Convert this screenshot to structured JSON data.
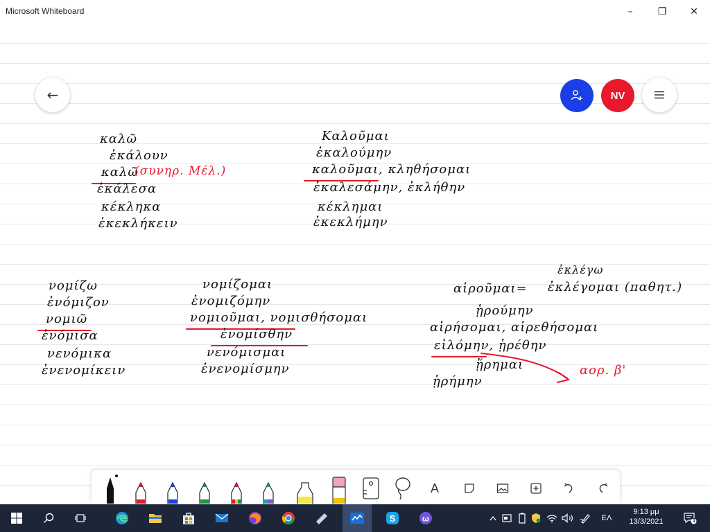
{
  "window": {
    "title": "Microsoft Whiteboard",
    "minimize": "–",
    "maximize": "❐",
    "close": "✕"
  },
  "header": {
    "back_symbol": "←",
    "avatar_initials": "NV"
  },
  "colors": {
    "ink": "#111111",
    "accent_red": "#e8192c",
    "share_blue": "#1b3fe6",
    "taskbar": "#1c2638"
  },
  "board": {
    "block1": {
      "lines": [
        "καλῶ",
        "ἐκάλουν",
        "καλῶ",
        "ἐκάλεσα",
        "κέκληκα",
        "ἐκεκλήκειν"
      ],
      "note": "(συνηρ. Μέλ.)"
    },
    "block2": {
      "lines": [
        "Καλοῦμαι",
        "ἐκαλούμην",
        "καλοῦμαι, κληθήσομαι",
        "ἐκαλεσάμην, ἐκλήθην",
        "κέκλημαι",
        "ἐκεκλήμην"
      ]
    },
    "block3": {
      "lines": [
        "νομίζω",
        "ἐνόμιζον",
        "νομιῶ",
        "ἐνόμισα",
        "νενόμικα",
        "ἐνενομίκειν"
      ]
    },
    "block4": {
      "lines": [
        "νομίζομαι",
        "ἐνομιζόμην",
        "νομιοῦμαι, νομισθήσομαι",
        "ἐνομίσθην",
        "νενόμισμαι",
        "ἐνενομίσμην"
      ]
    },
    "block5": {
      "top": "ἐκλέγω",
      "lines": [
        "αἱροῦμαι=",
        "ἐκλέγομαι (παθητ.)",
        "ᾑρούμην",
        "αἱρήσομαι, αἱρεθήσομαι",
        "εἱλόμην, ᾑρέθην",
        "ᾕρημαι",
        "ᾑρήμην"
      ],
      "note": "αορ. β'"
    }
  },
  "toolbar": {
    "text_tool": "A"
  },
  "taskbar": {
    "language": "ΕΛ",
    "time": "9:13 μμ",
    "date": "13/3/2021",
    "notifications": "1"
  }
}
